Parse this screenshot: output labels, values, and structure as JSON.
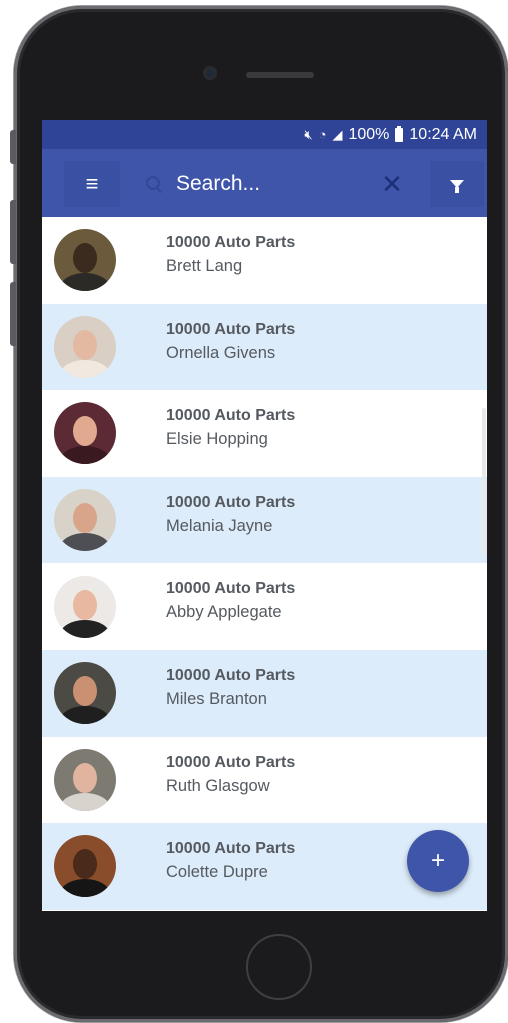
{
  "status_bar": {
    "icons": [
      "mute-icon",
      "wifi-icon",
      "signal-icon"
    ],
    "battery": "100%",
    "time": "10:24 AM"
  },
  "app_bar": {
    "menu_icon": "menu-icon",
    "search_placeholder": "Search...",
    "clear_icon": "close-icon",
    "clear_glyph": "✕",
    "filter_icon": "filter-icon"
  },
  "contacts": [
    {
      "company": "10000 Auto Parts",
      "name": "Brett Lang"
    },
    {
      "company": "10000 Auto Parts",
      "name": "Ornella Givens"
    },
    {
      "company": "10000 Auto Parts",
      "name": "Elsie Hopping"
    },
    {
      "company": "10000 Auto Parts",
      "name": "Melania Jayne"
    },
    {
      "company": "10000 Auto Parts",
      "name": "Abby Applegate"
    },
    {
      "company": "10000 Auto Parts",
      "name": "Miles Branton"
    },
    {
      "company": "10000 Auto Parts",
      "name": "Ruth Glasgow"
    },
    {
      "company": "10000 Auto Parts",
      "name": "Colette Dupre"
    }
  ],
  "fab": {
    "label": "+",
    "icon": "add-icon"
  },
  "colors": {
    "status_bar": "#2f4497",
    "app_bar": "#3f55a9",
    "row_alt": "#ddecfb",
    "text": "#555a60"
  }
}
